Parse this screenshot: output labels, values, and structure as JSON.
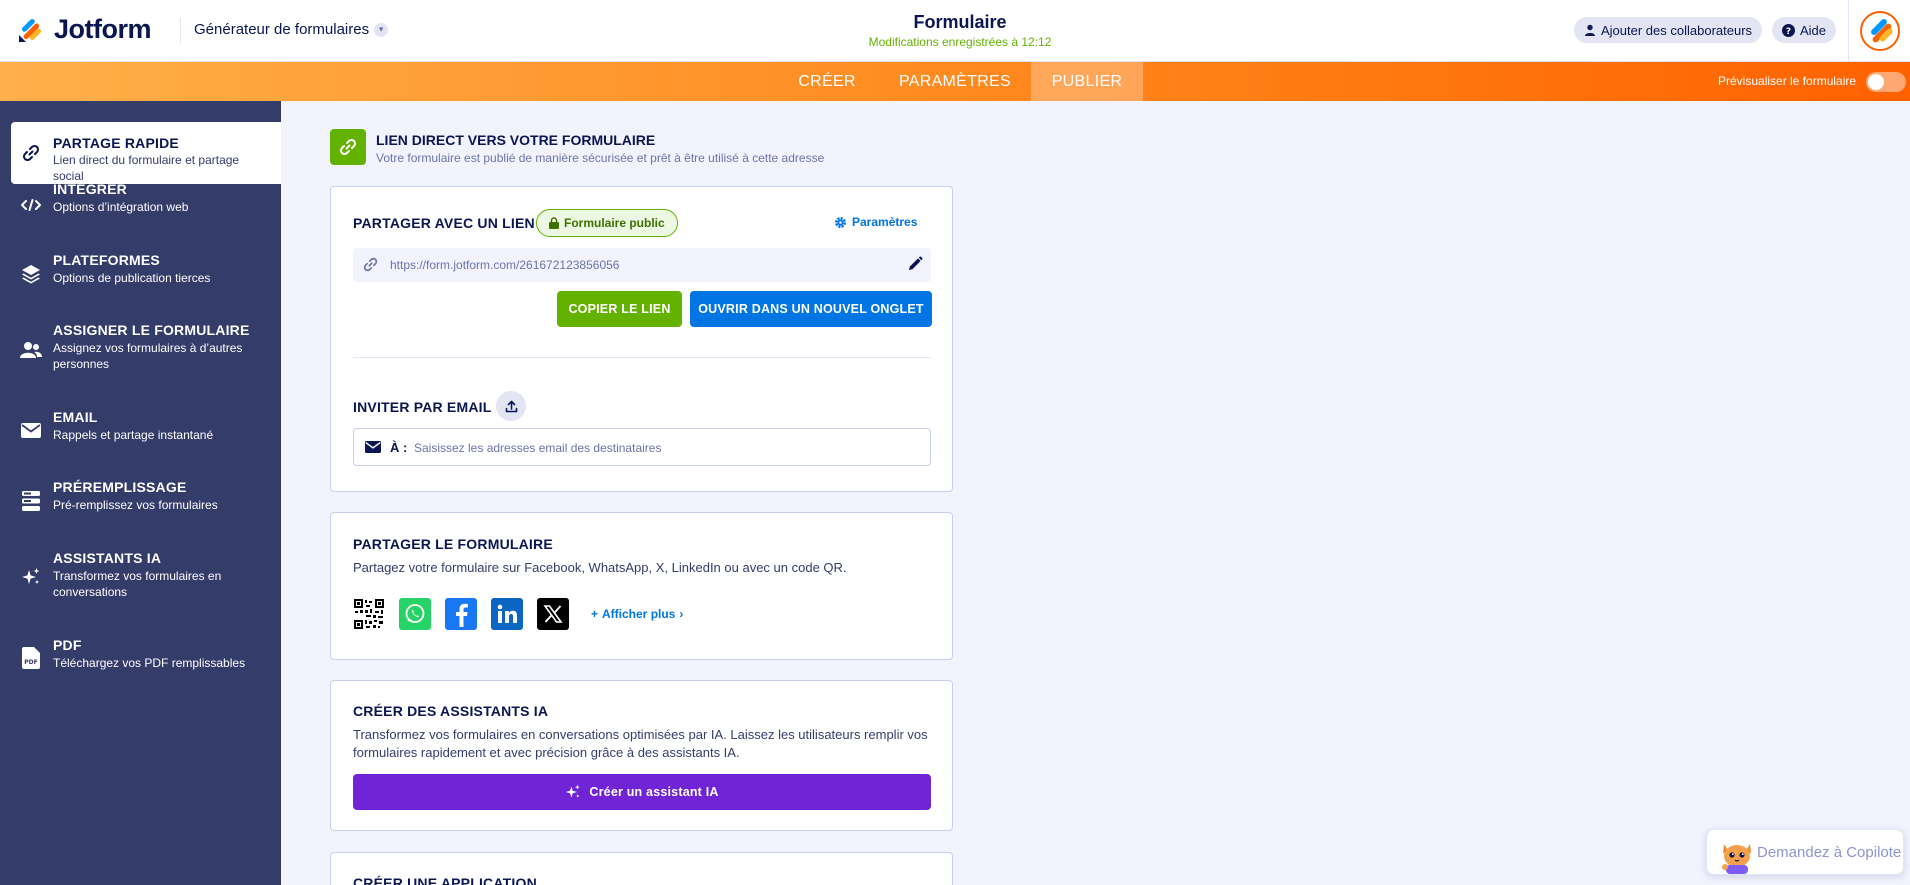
{
  "header": {
    "logo_text": "Jotform",
    "builder_label": "Générateur de formulaires",
    "form_title": "Formulaire",
    "saved_status": "Modifications enregistrées à 12:12",
    "add_collaborators": "Ajouter des collaborateurs",
    "help": "Aide"
  },
  "nav": {
    "tabs": [
      "CRÉER",
      "PARAMÈTRES",
      "PUBLIER"
    ],
    "active_tab": "PUBLIER",
    "preview_label": "Prévisualiser le formulaire",
    "preview_enabled": false
  },
  "sidebar": {
    "items": [
      {
        "title": "PARTAGE RAPIDE",
        "desc": "Lien direct du formulaire et partage social",
        "icon": "link-icon",
        "active": true
      },
      {
        "title": "INTÉGRER",
        "desc": "Options d’intégration web",
        "icon": "code-icon",
        "active": false
      },
      {
        "title": "PLATEFORMES",
        "desc": "Options de publication tierces",
        "icon": "layers-icon",
        "active": false
      },
      {
        "title": "ASSIGNER LE FORMULAIRE",
        "desc": "Assignez vos formulaires à d’autres personnes",
        "icon": "users-icon",
        "active": false
      },
      {
        "title": "EMAIL",
        "desc": "Rappels et partage instantané",
        "icon": "envelope-icon",
        "active": false
      },
      {
        "title": "PRÉREMPLISSAGE",
        "desc": "Pré-remplissez vos formulaires",
        "icon": "prefill-icon",
        "active": false
      },
      {
        "title": "ASSISTANTS IA",
        "desc": "Transformez vos formulaires en conversations",
        "icon": "sparkle-icon",
        "active": false
      },
      {
        "title": "PDF",
        "desc": "Téléchargez vos PDF remplissables",
        "icon": "pdf-icon",
        "active": false
      }
    ]
  },
  "direct_link": {
    "title": "LIEN DIRECT VERS VOTRE FORMULAIRE",
    "subtitle": "Votre formulaire est publié de manière sécurisée et prêt à être utilisé à cette adresse"
  },
  "share_link": {
    "title": "PARTAGER AVEC UN LIEN",
    "badge": "Formulaire public",
    "settings": "Paramètres",
    "url": "https://form.jotform.com/261672123856056",
    "copy_button": "COPIER LE LIEN",
    "open_button": "OUVRIR DANS UN NOUVEL ONGLET"
  },
  "invite": {
    "title": "INVITER PAR EMAIL",
    "to_label": "À :",
    "placeholder": "Saisissez les adresses email des destinataires"
  },
  "social": {
    "title": "PARTAGER LE FORMULAIRE",
    "desc": "Partagez votre formulaire sur Facebook, WhatsApp, X, LinkedIn ou avec un code QR.",
    "icons": [
      "qr-code-icon",
      "whatsapp-icon",
      "facebook-icon",
      "linkedin-icon",
      "x-icon"
    ],
    "show_more": "Afficher plus"
  },
  "ai": {
    "title": "CRÉER DES ASSISTANTS IA",
    "desc": "Transformez vos formulaires en conversations optimisées par IA. Laissez les utilisateurs remplir vos formulaires rapidement et avec précision grâce à des assistants IA.",
    "button": "Créer un assistant IA"
  },
  "app": {
    "title": "CRÉER UNE APPLICATION"
  },
  "copilot": {
    "label": "Demandez à Copilote"
  },
  "colors": {
    "navy": "#0a1551",
    "sidebar": "#343c6a",
    "green": "#64b200",
    "blue": "#0075e3",
    "purple": "#7024d6",
    "orange": "#ff6100"
  }
}
